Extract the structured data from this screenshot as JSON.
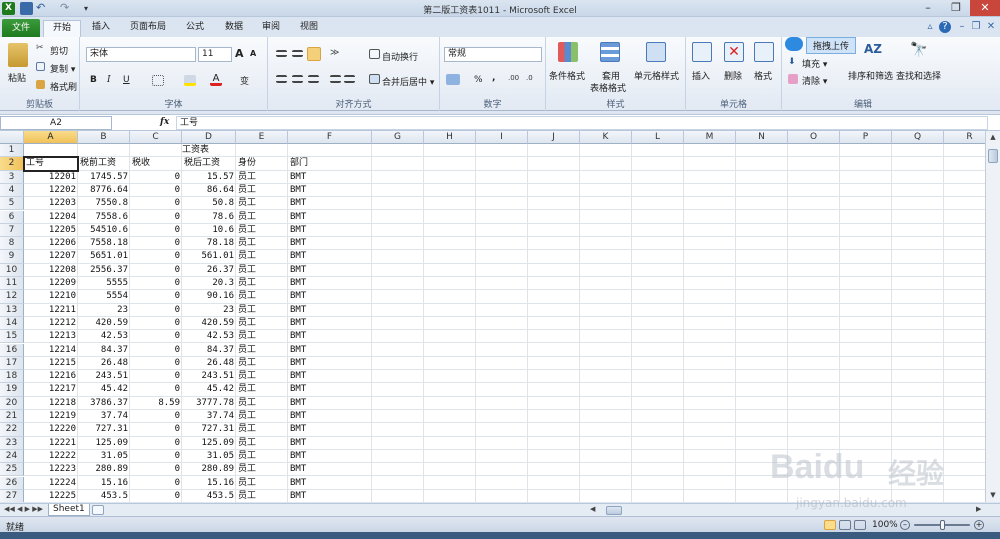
{
  "window": {
    "title": "第二版工资表1011 - Microsoft Excel"
  },
  "tabs": [
    "文件",
    "开始",
    "插入",
    "页面布局",
    "公式",
    "数据",
    "审阅",
    "视图"
  ],
  "ribbon": {
    "clipboard": {
      "paste": "粘贴",
      "cut": "剪切",
      "copy": "复制 ▾",
      "format_painter": "格式刷",
      "label": "剪贴板"
    },
    "font": {
      "name": "宋体",
      "size": "11",
      "grow": "A",
      "shrink": "A",
      "bold": "B",
      "italic": "I",
      "underline": "U",
      "label": "字体"
    },
    "alignment": {
      "wrap": "自动换行",
      "merge": "合并后居中 ▾",
      "label": "对齐方式"
    },
    "number": {
      "format": "常规",
      "percent": "%",
      "comma": ",",
      "label": "数字"
    },
    "styles": {
      "conditional": "条件格式",
      "table1": "套用",
      "table2": "表格格式",
      "cell": "单元格样式",
      "label": "样式"
    },
    "cells": {
      "insert": "插入",
      "delete": "删除",
      "format": "格式",
      "label": "单元格"
    },
    "editing": {
      "upload": "拖拽上传",
      "fill": "填充 ▾",
      "clear": "清除 ▾",
      "sort": "排序和筛选",
      "find": "查找和选择",
      "label": "编辑"
    }
  },
  "formula_bar": {
    "name_box": "A2",
    "fx": "fx",
    "content": "工号"
  },
  "columns": [
    "A",
    "B",
    "C",
    "D",
    "E",
    "F",
    "G",
    "H",
    "I",
    "J",
    "K",
    "L",
    "M",
    "N",
    "O",
    "P",
    "Q",
    "R"
  ],
  "sheet": {
    "title_row": {
      "row": "1",
      "text": "工资表"
    },
    "header_row": {
      "row": "2",
      "cells": [
        "工号",
        "税前工资",
        "税收",
        "税后工资",
        "身份",
        "部门"
      ]
    },
    "rows": [
      {
        "row": "3",
        "id": "12201",
        "pre": "1745.57",
        "tax": "0",
        "post": "15.57",
        "role": "员工",
        "dept": "BMT"
      },
      {
        "row": "4",
        "id": "12202",
        "pre": "8776.64",
        "tax": "0",
        "post": "86.64",
        "role": "员工",
        "dept": "BMT"
      },
      {
        "row": "5",
        "id": "12203",
        "pre": "7550.8",
        "tax": "0",
        "post": "50.8",
        "role": "员工",
        "dept": "BMT"
      },
      {
        "row": "6",
        "id": "12204",
        "pre": "7558.6",
        "tax": "0",
        "post": "78.6",
        "role": "员工",
        "dept": "BMT"
      },
      {
        "row": "7",
        "id": "12205",
        "pre": "54510.6",
        "tax": "0",
        "post": "10.6",
        "role": "员工",
        "dept": "BMT"
      },
      {
        "row": "8",
        "id": "12206",
        "pre": "7558.18",
        "tax": "0",
        "post": "78.18",
        "role": "员工",
        "dept": "BMT"
      },
      {
        "row": "9",
        "id": "12207",
        "pre": "5651.01",
        "tax": "0",
        "post": "561.01",
        "role": "员工",
        "dept": "BMT"
      },
      {
        "row": "10",
        "id": "12208",
        "pre": "2556.37",
        "tax": "0",
        "post": "26.37",
        "role": "员工",
        "dept": "BMT"
      },
      {
        "row": "11",
        "id": "12209",
        "pre": "5555",
        "tax": "0",
        "post": "20.3",
        "role": "员工",
        "dept": "BMT"
      },
      {
        "row": "12",
        "id": "12210",
        "pre": "5554",
        "tax": "0",
        "post": "90.16",
        "role": "员工",
        "dept": "BMT"
      },
      {
        "row": "13",
        "id": "12211",
        "pre": "23",
        "tax": "0",
        "post": "23",
        "role": "员工",
        "dept": "BMT"
      },
      {
        "row": "14",
        "id": "12212",
        "pre": "420.59",
        "tax": "0",
        "post": "420.59",
        "role": "员工",
        "dept": "BMT"
      },
      {
        "row": "15",
        "id": "12213",
        "pre": "42.53",
        "tax": "0",
        "post": "42.53",
        "role": "员工",
        "dept": "BMT"
      },
      {
        "row": "16",
        "id": "12214",
        "pre": "84.37",
        "tax": "0",
        "post": "84.37",
        "role": "员工",
        "dept": "BMT"
      },
      {
        "row": "17",
        "id": "12215",
        "pre": "26.48",
        "tax": "0",
        "post": "26.48",
        "role": "员工",
        "dept": "BMT"
      },
      {
        "row": "18",
        "id": "12216",
        "pre": "243.51",
        "tax": "0",
        "post": "243.51",
        "role": "员工",
        "dept": "BMT"
      },
      {
        "row": "19",
        "id": "12217",
        "pre": "45.42",
        "tax": "0",
        "post": "45.42",
        "role": "员工",
        "dept": "BMT"
      },
      {
        "row": "20",
        "id": "12218",
        "pre": "3786.37",
        "tax": "8.59",
        "post": "3777.78",
        "role": "员工",
        "dept": "BMT"
      },
      {
        "row": "21",
        "id": "12219",
        "pre": "37.74",
        "tax": "0",
        "post": "37.74",
        "role": "员工",
        "dept": "BMT"
      },
      {
        "row": "22",
        "id": "12220",
        "pre": "727.31",
        "tax": "0",
        "post": "727.31",
        "role": "员工",
        "dept": "BMT"
      },
      {
        "row": "23",
        "id": "12221",
        "pre": "125.09",
        "tax": "0",
        "post": "125.09",
        "role": "员工",
        "dept": "BMT"
      },
      {
        "row": "24",
        "id": "12222",
        "pre": "31.05",
        "tax": "0",
        "post": "31.05",
        "role": "员工",
        "dept": "BMT"
      },
      {
        "row": "25",
        "id": "12223",
        "pre": "280.89",
        "tax": "0",
        "post": "280.89",
        "role": "员工",
        "dept": "BMT"
      },
      {
        "row": "26",
        "id": "12224",
        "pre": "15.16",
        "tax": "0",
        "post": "15.16",
        "role": "员工",
        "dept": "BMT"
      },
      {
        "row": "27",
        "id": "12225",
        "pre": "453.5",
        "tax": "0",
        "post": "453.5",
        "role": "员工",
        "dept": "BMT"
      }
    ]
  },
  "sheet_tabs": [
    "Sheet1"
  ],
  "status": {
    "ready": "就绪",
    "zoom": "100%"
  },
  "watermark": {
    "brand": "Baidu",
    "cn": "经验",
    "url": "jingyan.baidu.com"
  },
  "colors": {
    "file_tab": "#1d7a1d",
    "selection": "#f1c15a",
    "grid_line": "#dfe4ea",
    "ribbon_bg": "#e2e9f3"
  }
}
